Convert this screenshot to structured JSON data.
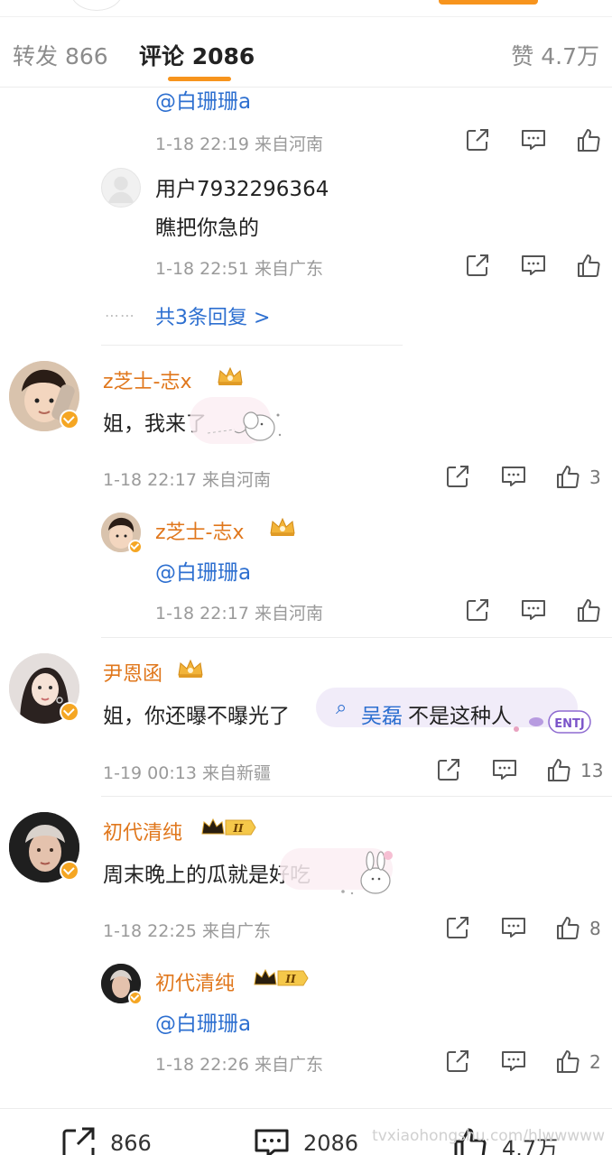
{
  "tabs": {
    "repost": "转发 866",
    "comments": "评论 2086",
    "likes": "赞 4.7万"
  },
  "thread1": {
    "reply_a": {
      "mention": "@白珊珊a",
      "meta": "1-18 22:19 来自河南"
    },
    "reply_b": {
      "user": "用户7932296364",
      "text": "瞧把你急的",
      "meta": "1-18 22:51 来自广东"
    },
    "more": "共3条回复 >"
  },
  "comment2": {
    "user": "z芝士-志x",
    "text": "姐，我来了",
    "meta": "1-18 22:17 来自河南",
    "likes": "3",
    "reply": {
      "user": "z芝士-志x",
      "mention": "@白珊珊a",
      "meta": "1-18 22:17 来自河南"
    }
  },
  "comment3": {
    "user": "尹恩函",
    "text_before": "姐，你还曝不曝光了",
    "search_term": "吴磊",
    "text_after": "不是这种人",
    "meta": "1-19 00:13 来自新疆",
    "likes": "13",
    "sticker_text": "ENTJ"
  },
  "comment4": {
    "user": "初代清纯",
    "level": "II",
    "text": "周末晚上的瓜就是好吃",
    "meta": "1-18 22:25 来自广东",
    "likes": "8",
    "reply": {
      "user": "初代清纯",
      "mention": "@白珊珊a",
      "meta": "1-18 22:26 来自广东",
      "likes": "2"
    }
  },
  "bottom_bar": {
    "repost": "866",
    "comment": "2086",
    "like": "4.7万",
    "watermark": "tvxiaohongshu.com/hlwwwww"
  },
  "colors": {
    "accent": "#f7941d",
    "username": "#e0771c",
    "link": "#2d6fd0",
    "meta": "#9a9a9a"
  },
  "icons": {
    "share": "share-icon",
    "comment": "comment-icon",
    "like": "thumbs-up-icon"
  }
}
